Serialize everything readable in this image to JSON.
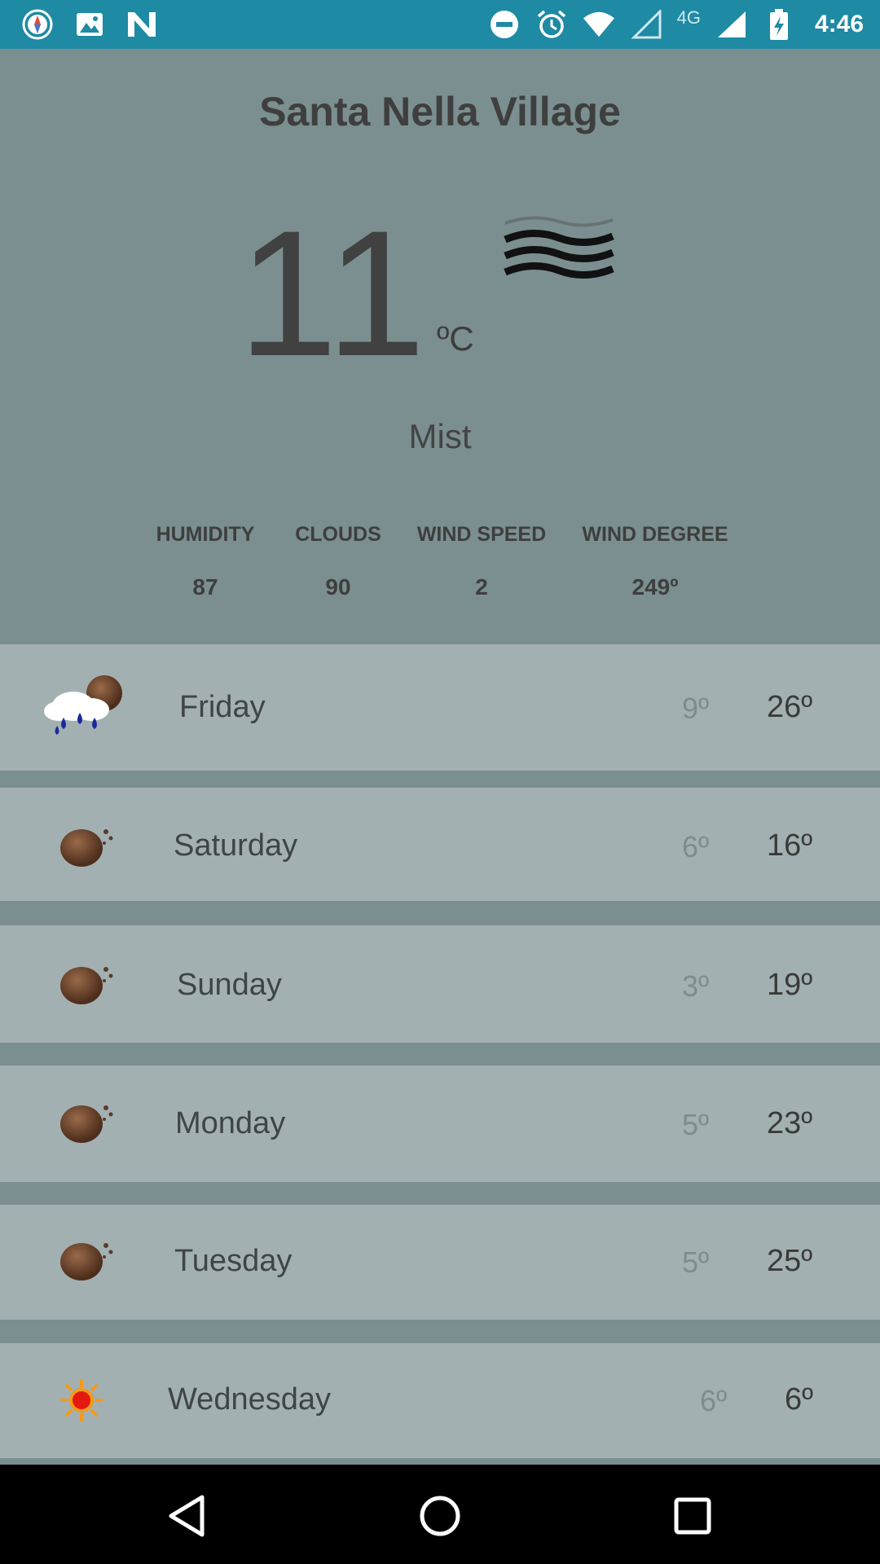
{
  "status_bar": {
    "time": "4:46",
    "network": "4G",
    "left_icons": [
      "compass-icon",
      "image-icon",
      "n-logo-icon"
    ],
    "right_icons": [
      "do-not-disturb-icon",
      "alarm-icon",
      "wifi-icon",
      "signal-empty-icon",
      "signal-icon",
      "battery-charging-icon"
    ],
    "background": "#1e8aa3"
  },
  "current": {
    "city": "Santa Nella Village",
    "temperature": "11",
    "unit": "ºC",
    "description": "Mist",
    "icon": "mist-icon",
    "stats": [
      {
        "label": "HUMIDITY",
        "value": "87"
      },
      {
        "label": "CLOUDS",
        "value": "90"
      },
      {
        "label": "WIND SPEED",
        "value": "2"
      },
      {
        "label": "WIND DEGREE",
        "value": "249º"
      }
    ],
    "background": "#7b8f90"
  },
  "forecast": [
    {
      "day": "Friday",
      "low": "9º",
      "high": "26º",
      "icon": "rain-cloud-icon"
    },
    {
      "day": "Saturday",
      "low": "6º",
      "high": "16º",
      "icon": "brown-planet-icon"
    },
    {
      "day": "Sunday",
      "low": "3º",
      "high": "19º",
      "icon": "brown-planet-icon"
    },
    {
      "day": "Monday",
      "low": "5º",
      "high": "23º",
      "icon": "brown-planet-icon"
    },
    {
      "day": "Tuesday",
      "low": "5º",
      "high": "25º",
      "icon": "brown-planet-icon"
    },
    {
      "day": "Wednesday",
      "low": "6º",
      "high": "6º",
      "icon": "sun-icon"
    }
  ],
  "nav_bar": {
    "buttons": [
      "back-icon",
      "home-icon",
      "recents-icon"
    ]
  }
}
